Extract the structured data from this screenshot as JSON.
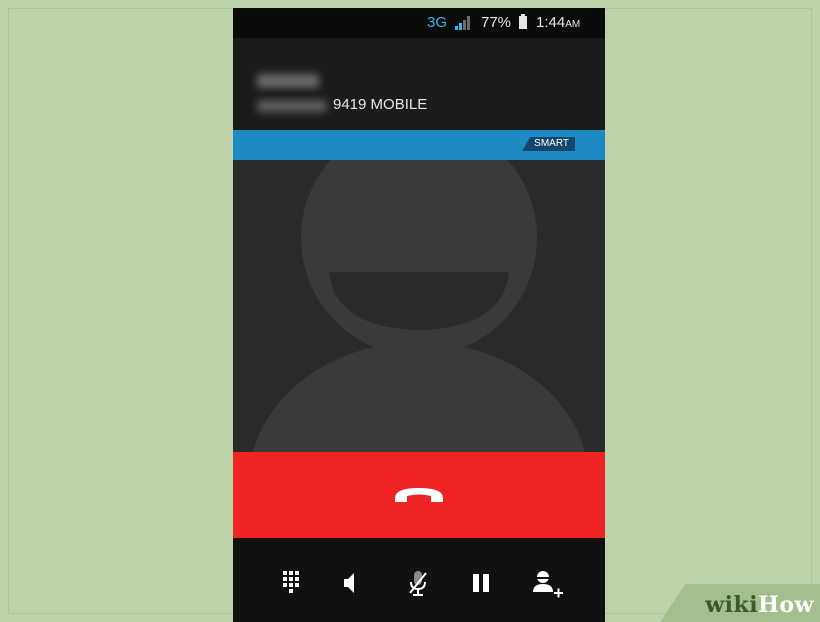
{
  "status_bar": {
    "network": "3G",
    "battery_percent": "77%",
    "time": "1:44",
    "time_suffix": "AM"
  },
  "call": {
    "number_suffix": "9419",
    "number_type": "MOBILE",
    "carrier_badge": "SMART"
  },
  "actions": [
    {
      "name": "dialpad"
    },
    {
      "name": "speaker"
    },
    {
      "name": "mute"
    },
    {
      "name": "hold"
    },
    {
      "name": "add-call"
    }
  ],
  "watermark": {
    "part1": "wiki",
    "part2": "How"
  },
  "colors": {
    "background": "#bed3a9",
    "phone": "#161616",
    "accent_blue": "#1e8ac4",
    "end_call_red": "#ee2424"
  }
}
